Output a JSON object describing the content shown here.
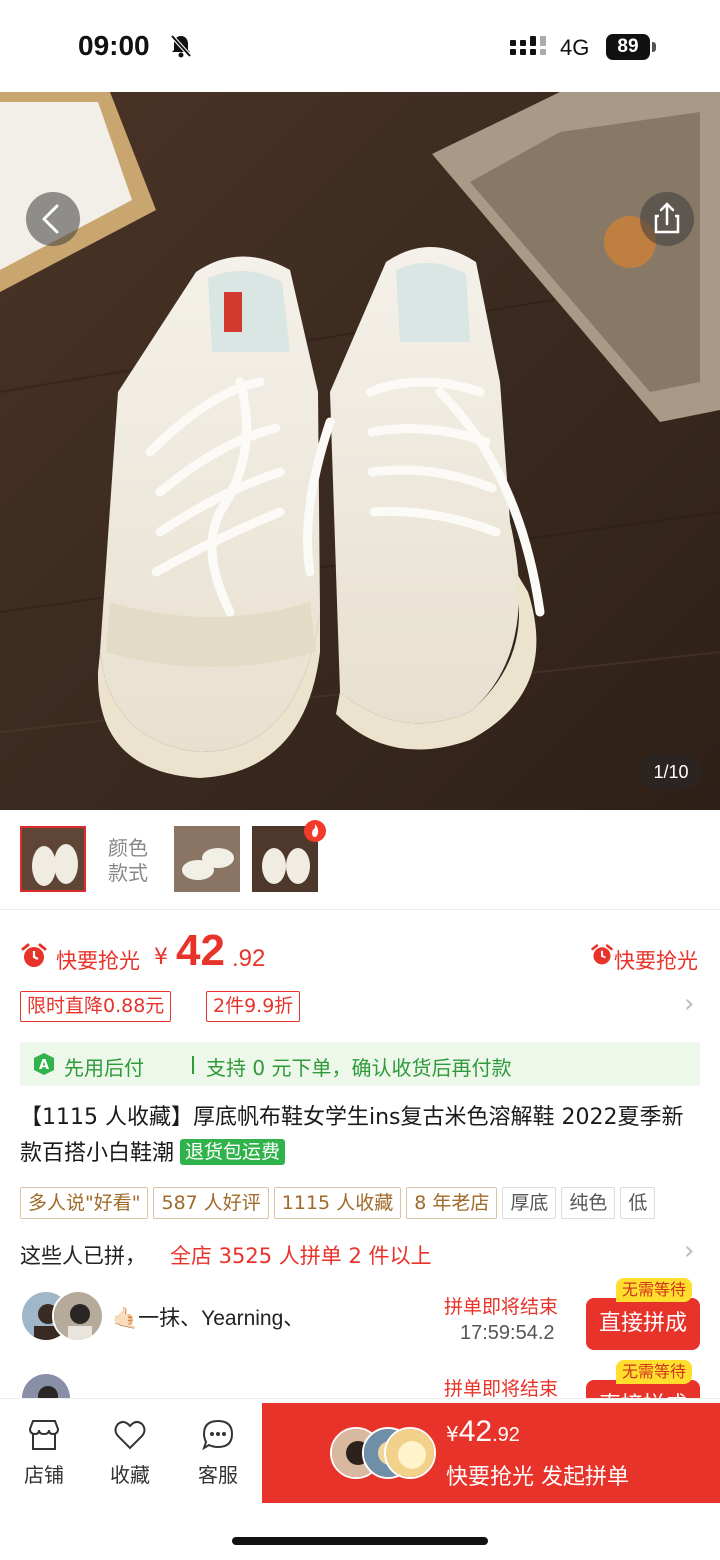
{
  "status_bar": {
    "time": "09:00",
    "network": "4G",
    "battery": "89"
  },
  "gallery": {
    "page_indicator": "1/10"
  },
  "variants": {
    "label_line1": "颜色",
    "label_line2": "款式"
  },
  "price": {
    "flash_label": "快要抢光",
    "currency": "¥",
    "integer": "42",
    "decimal": ".92",
    "right_label": "快要抢光"
  },
  "promos": [
    "限时直降0.88元",
    "2件9.9折"
  ],
  "pay_later": {
    "title": "先用后付",
    "desc": "支持 0 元下单，确认收货后再付款"
  },
  "product": {
    "title": "【1115 人收藏】厚底帆布鞋女学生ins复古米色溶解鞋 2022夏季新款百搭小白鞋潮",
    "badge": "退货包运费"
  },
  "tags": [
    "多人说\"好看\"",
    "587 人好评",
    "1115 人收藏",
    "8 年老店",
    "厚底",
    "纯色",
    "低"
  ],
  "joined": {
    "prefix": "这些人已拼，",
    "highlight": "全店 3525 人拼单 2 件以上"
  },
  "groups": [
    {
      "names": "🤙🏻一抹、Yearning、",
      "status": "拼单即将结束",
      "timer": "17:59:54.2",
      "button": "直接拼成",
      "badge": "无需等待"
    },
    {
      "names": "",
      "status": "拼单即将结束",
      "timer": "",
      "button": "直接拼成",
      "badge": "无需等待"
    }
  ],
  "bottom_nav": [
    {
      "label": "店铺",
      "icon": "store-icon"
    },
    {
      "label": "收藏",
      "icon": "heart-icon"
    },
    {
      "label": "客服",
      "icon": "chat-icon"
    }
  ],
  "cta": {
    "currency": "¥",
    "integer": "42",
    "decimal": ".92",
    "label": "快要抢光 发起拼单"
  },
  "colors": {
    "accent": "#e8332a",
    "green": "#2e9a3a",
    "tag_gold": "#a06a2a",
    "wait_badge": "#ffde2e"
  }
}
